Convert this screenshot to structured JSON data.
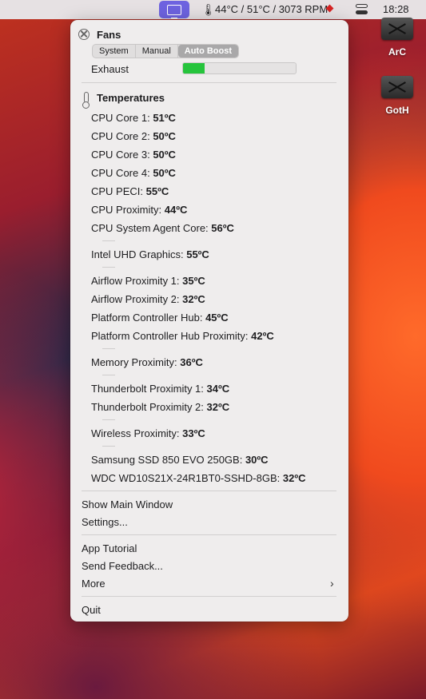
{
  "menubar": {
    "stats": "44°C / 51°C / 3073 RPM",
    "clock": "18:28",
    "icons": [
      "app-screen-icon",
      "thermometer-icon",
      "warning-diamond-icon",
      "control-center-icon"
    ]
  },
  "desktop": {
    "items": [
      {
        "label": "ArC"
      },
      {
        "label": "GotH"
      }
    ]
  },
  "fans": {
    "title": "Fans",
    "modes": [
      "System",
      "Manual",
      "Auto Boost"
    ],
    "selected_mode": "Auto Boost",
    "fan_label": "Exhaust",
    "fan_level_fraction": 0.19
  },
  "temps": {
    "title": "Temperatures",
    "sensors": [
      {
        "name": "CPU Core 1:",
        "value": "51ºC"
      },
      {
        "name": "CPU Core 2:",
        "value": "50ºC"
      },
      {
        "name": "CPU Core 3:",
        "value": "50ºC"
      },
      {
        "name": "CPU Core 4:",
        "value": "50ºC"
      },
      {
        "name": "CPU PECI:",
        "value": "55ºC"
      },
      {
        "name": "CPU Proximity:",
        "value": "44ºC"
      },
      {
        "name": "CPU System Agent Core:",
        "value": "56ºC"
      },
      {
        "name": "Intel UHD Graphics:",
        "value": "55ºC"
      },
      {
        "name": "Airflow Proximity 1:",
        "value": "35ºC"
      },
      {
        "name": "Airflow Proximity 2:",
        "value": "32ºC"
      },
      {
        "name": "Platform Controller Hub:",
        "value": "45ºC"
      },
      {
        "name": "Platform Controller Hub Proximity:",
        "value": "42ºC"
      },
      {
        "name": "Memory Proximity:",
        "value": "36ºC"
      },
      {
        "name": "Thunderbolt Proximity 1:",
        "value": "34ºC"
      },
      {
        "name": "Thunderbolt Proximity 2:",
        "value": "32ºC"
      },
      {
        "name": "Wireless Proximity:",
        "value": "33ºC"
      },
      {
        "name": "Samsung SSD 850 EVO 250GB:",
        "value": "30ºC"
      },
      {
        "name": "WDC WD10S21X-24R1BT0-SSHD-8GB:",
        "value": "32ºC"
      }
    ]
  },
  "actions": {
    "show_main": "Show Main Window",
    "settings": "Settings...",
    "tutorial": "App Tutorial",
    "feedback": "Send Feedback...",
    "more": "More",
    "quit": "Quit"
  },
  "colors": {
    "accent": "#6e63e0",
    "fan_fill": "#26c43c",
    "warning": "#d62323"
  }
}
